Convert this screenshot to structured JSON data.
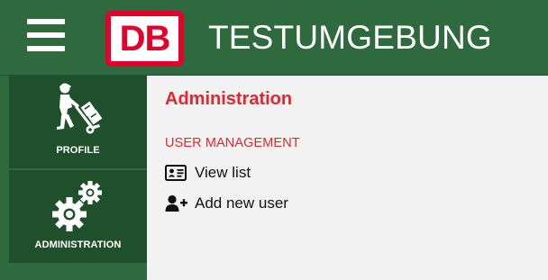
{
  "header": {
    "menu_icon": "hamburger-menu-icon",
    "logo_text": "DB",
    "title": "TESTUMGEBUNG",
    "colors": {
      "bar": "#2f6a3f",
      "logo_red": "#e5002b"
    }
  },
  "sidebar": {
    "items": [
      {
        "label": "PROFILE",
        "icon": "person-with-hand-truck-icon"
      },
      {
        "label": "ADMINISTRATION",
        "icon": "gears-icon"
      }
    ],
    "colors": {
      "item_bg": "#1f4f2b"
    }
  },
  "main": {
    "title": "Administration",
    "section_heading": "USER MANAGEMENT",
    "links": [
      {
        "label": "View list",
        "icon": "id-card-icon"
      },
      {
        "label": "Add new user",
        "icon": "user-plus-icon"
      }
    ],
    "colors": {
      "accent": "#e5262f",
      "background": "#f2f2f2"
    }
  }
}
